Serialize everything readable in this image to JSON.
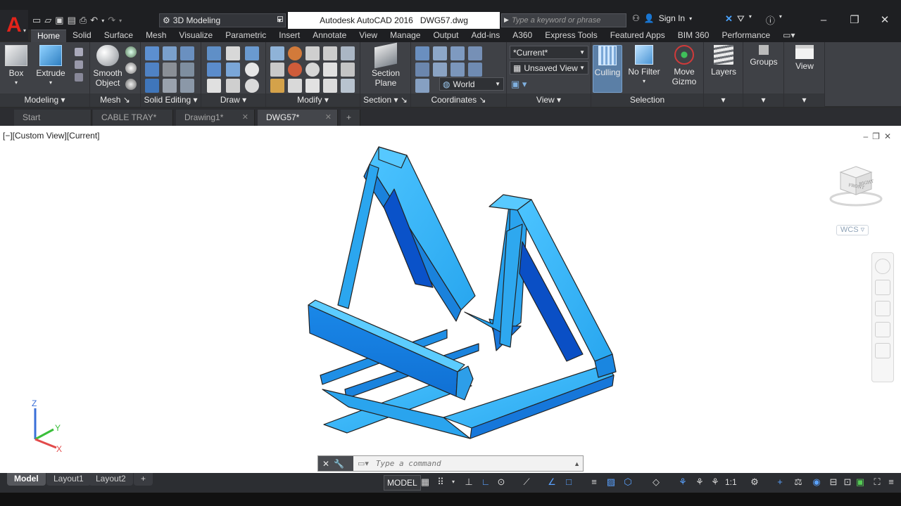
{
  "app": {
    "title": "Autodesk AutoCAD 2016",
    "filename": "DWG57.dwg",
    "workspace": "3D Modeling",
    "search_placeholder": "Type a keyword or phrase",
    "sign_in": "Sign In"
  },
  "ribbon_tabs": [
    "Home",
    "Solid",
    "Surface",
    "Mesh",
    "Visualize",
    "Parametric",
    "Insert",
    "Annotate",
    "View",
    "Manage",
    "Output",
    "Add-ins",
    "A360",
    "Express Tools",
    "Featured Apps",
    "BIM 360",
    "Performance"
  ],
  "ribbon": {
    "panels": {
      "modeling": "Modeling",
      "mesh": "Mesh",
      "solid_editing": "Solid Editing",
      "draw": "Draw",
      "modify": "Modify",
      "section": "Section",
      "coordinates": "Coordinates",
      "view": "View",
      "selection": "Selection"
    },
    "buttons": {
      "box": "Box",
      "extrude": "Extrude",
      "smooth_object_1": "Smooth",
      "smooth_object_2": "Object",
      "section_plane_1": "Section",
      "section_plane_2": "Plane",
      "culling": "Culling",
      "no_filter": "No Filter",
      "move_gizmo_1": "Move",
      "move_gizmo_2": "Gizmo",
      "layers": "Layers",
      "groups": "Groups",
      "view": "View"
    },
    "dropdowns": {
      "visual_style": "*Current*",
      "named_view": "Unsaved View",
      "ucs": "World"
    }
  },
  "file_tabs": [
    {
      "label": "Start",
      "active": false,
      "closable": false
    },
    {
      "label": "CABLE TRAY*",
      "active": false,
      "closable": false
    },
    {
      "label": "Drawing1*",
      "active": false,
      "closable": true
    },
    {
      "label": "DWG57*",
      "active": true,
      "closable": true
    }
  ],
  "viewport": {
    "label": "[−][Custom View][Current]",
    "viewcube_faces": {
      "front": "FRONT",
      "right": "RIGHT"
    },
    "wcs": "WCS",
    "ucs_axes": {
      "x": "X",
      "y": "Y",
      "z": "Z"
    },
    "model_color": "#2fb0f4"
  },
  "command_line": {
    "placeholder": "Type a command"
  },
  "layout_tabs": [
    "Model",
    "Layout1",
    "Layout2"
  ],
  "status_bar": {
    "model": "MODEL",
    "scale": "1:1"
  }
}
